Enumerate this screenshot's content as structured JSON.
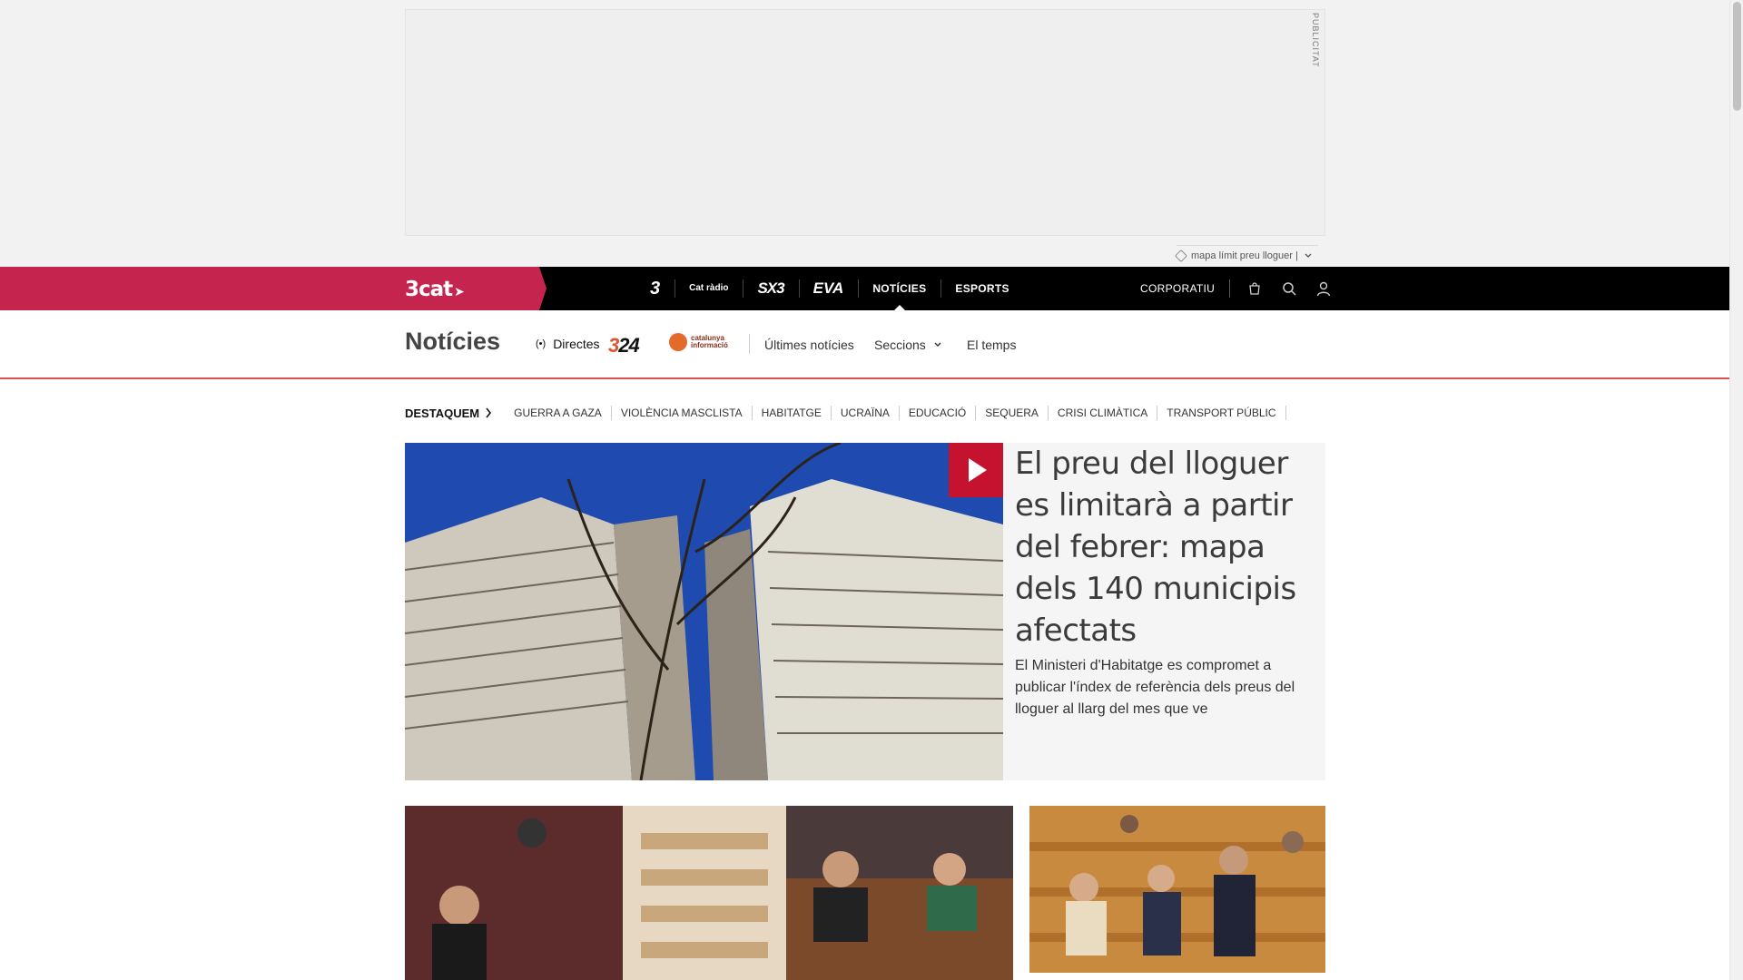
{
  "ad": {
    "label": "PUBLICITAT",
    "tag_text": "mapa límit preu lloguer |"
  },
  "topnav": {
    "brand": "3cat",
    "channels": [
      {
        "label": "3",
        "icon": "tv3-logo"
      },
      {
        "label": "Cat ràdio",
        "icon": "catradio-logo"
      },
      {
        "label": "SX3",
        "icon": "sx3-logo"
      },
      {
        "label": "EVA",
        "icon": "eva-logo"
      },
      {
        "label": "NOTÍCIES",
        "active": true
      },
      {
        "label": "ESPORTS"
      }
    ],
    "corporate": "CORPORATIU",
    "icons": [
      "shopping-bag-icon",
      "search-icon",
      "user-icon"
    ]
  },
  "section": {
    "title": "Notícies",
    "directes": "Directes",
    "logo_324": {
      "a": "3",
      "b": "24"
    },
    "logo_ci": {
      "line1": "catalunya",
      "line2": "informació"
    },
    "links": [
      "Últimes notícies",
      "Seccions",
      "El temps"
    ]
  },
  "highlights": {
    "heading": "DESTAQUEM",
    "items": [
      "GUERRA A GAZA",
      "VIOLÈNCIA MASCLISTA",
      "HABITATGE",
      "UCRAÏNA",
      "EDUCACIÓ",
      "SEQUERA",
      "CRISI CLIMÀTICA",
      "TRANSPORT PÚBLIC"
    ]
  },
  "lead": {
    "title": "El preu del lloguer es limitarà a partir del febrer: mapa dels 140 municipis afectats",
    "summary": "El Ministeri d'Habitatge es compromet a publicar l'índex de referència dels preus del lloguer al llarg del mes que ve"
  },
  "colors": {
    "brand": "#c4244e",
    "play": "#c4122f",
    "section_rule": "#d9534f"
  }
}
